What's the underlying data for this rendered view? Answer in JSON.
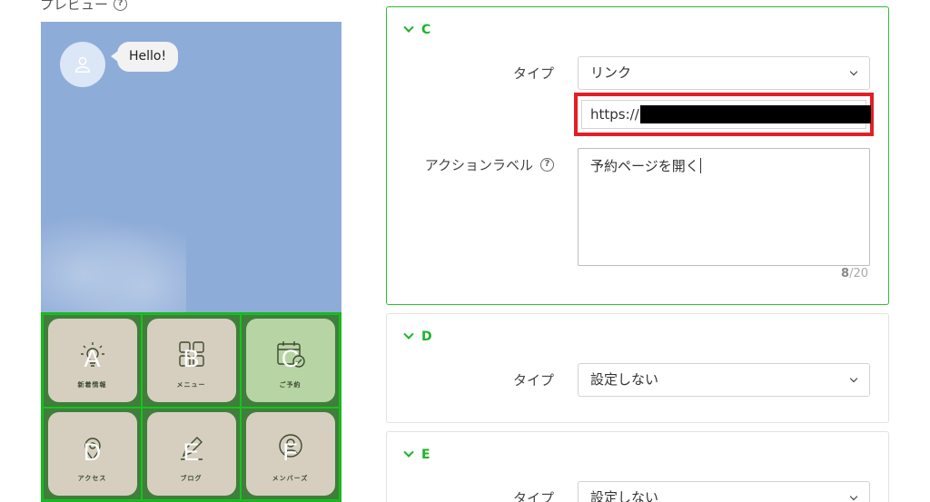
{
  "preview": {
    "title": "プレビュー",
    "chat_message": "Hello!",
    "menu": [
      {
        "letter": "A",
        "label": "新着情報",
        "icon": "lightbulb-icon",
        "active": false
      },
      {
        "letter": "B",
        "label": "メニュー",
        "icon": "grid-icon",
        "active": false
      },
      {
        "letter": "C",
        "label": "ご予約",
        "icon": "calendar-check-icon",
        "active": true
      },
      {
        "letter": "D",
        "label": "アクセス",
        "icon": "map-pin-icon",
        "active": false
      },
      {
        "letter": "E",
        "label": "ブログ",
        "icon": "pencil-icon",
        "active": false
      },
      {
        "letter": "F",
        "label": "メンバーズ",
        "icon": "member-icon",
        "active": false
      }
    ]
  },
  "settings": {
    "c": {
      "header": "C",
      "type_label": "タイプ",
      "type_value": "リンク",
      "url_value": "https://",
      "action_label": "アクションラベル",
      "action_value": "予約ページを開く",
      "counter_current": "8",
      "counter_max": "/20"
    },
    "d": {
      "header": "D",
      "type_label": "タイプ",
      "type_value": "設定しない"
    },
    "e": {
      "header": "E",
      "type_label": "タイプ",
      "type_value": "設定しない"
    }
  },
  "colors": {
    "accent_green": "#1eb329",
    "highlight_red": "#e41e26",
    "preview_bg": "#8eacd8"
  }
}
